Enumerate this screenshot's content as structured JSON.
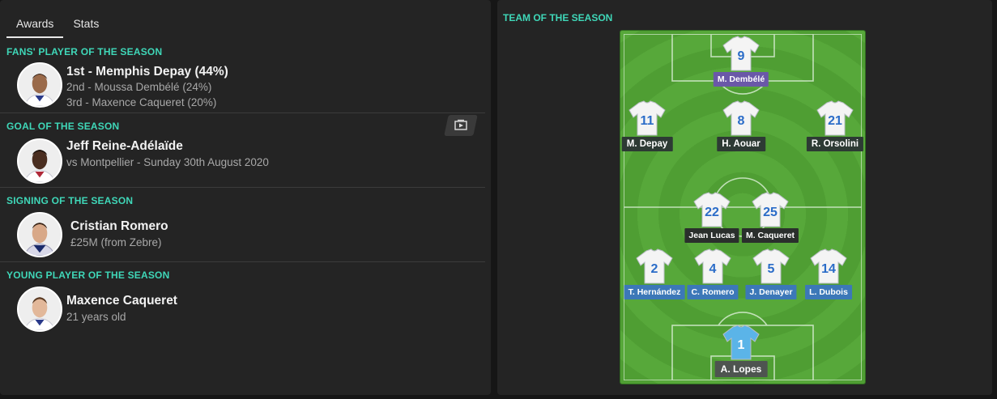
{
  "tabs": [
    {
      "label": "Awards"
    },
    {
      "label": "Stats"
    }
  ],
  "awards": {
    "fans": {
      "title": "FANS' PLAYER OF THE SEASON",
      "first": "1st - Memphis Depay (44%)",
      "second": "2nd - Moussa Dembélé (24%)",
      "third": "3rd - Maxence Caqueret (20%)"
    },
    "goal": {
      "title": "GOAL OF THE SEASON",
      "player": "Jeff Reine-Adélaïde",
      "detail": "vs Montpellier - Sunday 30th August 2020"
    },
    "signing": {
      "title": "SIGNING OF THE SEASON",
      "player": "Cristian Romero",
      "detail": "£25M (from Zebre)"
    },
    "young": {
      "title": "YOUNG PLAYER OF THE SEASON",
      "player": "Maxence Caqueret",
      "detail": "21 years old"
    }
  },
  "team": {
    "title": "TEAM OF THE SEASON",
    "players": {
      "st": {
        "number": "9",
        "name": "M. Dembélé"
      },
      "lw": {
        "number": "11",
        "name": "M. Depay"
      },
      "am": {
        "number": "8",
        "name": "H. Aouar"
      },
      "rw": {
        "number": "21",
        "name": "R. Orsolini"
      },
      "cm1": {
        "number": "22",
        "name": "Jean Lucas"
      },
      "cm2": {
        "number": "25",
        "name": "M. Caqueret"
      },
      "lb": {
        "number": "2",
        "name": "T. Hernández"
      },
      "cb1": {
        "number": "4",
        "name": "C. Romero"
      },
      "cb2": {
        "number": "5",
        "name": "J. Denayer"
      },
      "rb": {
        "number": "14",
        "name": "L. Dubois"
      },
      "gk": {
        "number": "1",
        "name": "A. Lopes"
      }
    }
  },
  "colors": {
    "accent": "#3fd7b8",
    "pitch_green": "#57a83a",
    "shirt_number": "#2a6cc8",
    "gk_shirt": "#5bb4e8"
  }
}
